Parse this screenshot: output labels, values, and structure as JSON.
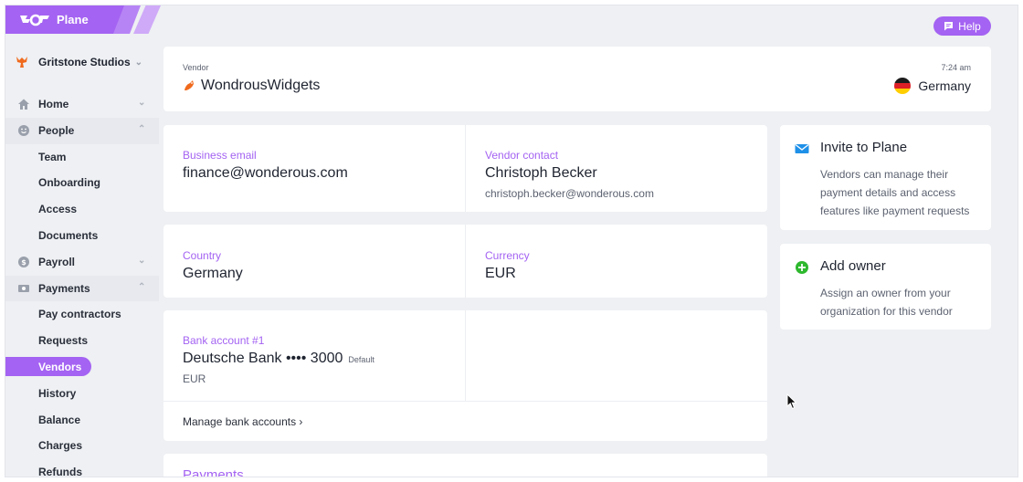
{
  "app": {
    "name": "Plane"
  },
  "org": {
    "name": "Gritstone Studios"
  },
  "sidebar": {
    "items": [
      {
        "label": "Home",
        "icon": "home-icon",
        "type": "group"
      },
      {
        "label": "People",
        "icon": "smile-icon",
        "type": "group-open"
      },
      {
        "label": "Team",
        "type": "sub"
      },
      {
        "label": "Onboarding",
        "type": "sub"
      },
      {
        "label": "Access",
        "type": "sub"
      },
      {
        "label": "Documents",
        "type": "sub"
      },
      {
        "label": "Payroll",
        "icon": "dollar-coin-icon",
        "type": "group"
      },
      {
        "label": "Payments",
        "icon": "banknote-icon",
        "type": "group-open"
      },
      {
        "label": "Pay contractors",
        "type": "sub"
      },
      {
        "label": "Requests",
        "type": "sub"
      },
      {
        "label": "Vendors",
        "type": "sub",
        "active": true
      },
      {
        "label": "History",
        "type": "sub"
      },
      {
        "label": "Balance",
        "type": "sub"
      },
      {
        "label": "Charges",
        "type": "sub"
      },
      {
        "label": "Refunds",
        "type": "sub"
      }
    ]
  },
  "header": {
    "help_label": "Help"
  },
  "vendor": {
    "label": "Vendor",
    "name": "WondrousWidgets",
    "local_time": "7:24 am",
    "country": "Germany"
  },
  "details": {
    "business_email_label": "Business email",
    "business_email": "finance@wonderous.com",
    "vendor_contact_label": "Vendor contact",
    "vendor_contact_name": "Christoph Becker",
    "vendor_contact_email": "christoph.becker@wonderous.com",
    "country_label": "Country",
    "country": "Germany",
    "currency_label": "Currency",
    "currency": "EUR"
  },
  "bank": {
    "label": "Bank account #1",
    "bank_name": "Deutsche Bank •••• 3000",
    "default_tag": "Default",
    "currency": "EUR",
    "manage_label": "Manage bank accounts ›"
  },
  "payments": {
    "title": "Payments"
  },
  "side_cards": {
    "invite": {
      "title": "Invite to Plane",
      "description": "Vendors can manage their payment details and access features like payment requests"
    },
    "owner": {
      "title": "Add owner",
      "description": "Assign an owner from your organization for this vendor"
    }
  },
  "colors": {
    "accent": "#a463f2",
    "background": "#eef0f3",
    "owner_icon": "#2eb82e",
    "invite_icon": "#1e90e8"
  }
}
